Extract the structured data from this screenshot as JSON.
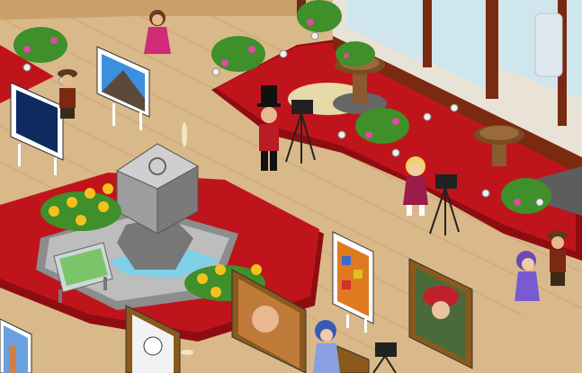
{
  "scene": {
    "title": "",
    "palette": {
      "floor": "#d9b98a",
      "floor_line": "#c9a472",
      "carpet": "#c0141c",
      "carpet_dark": "#8f0d12",
      "stone": "#8d8d8d",
      "stone_light": "#bdbdbd",
      "wall": "#e9e2d6",
      "window_frame": "#7a2a10",
      "window_glass": "#cfe6ee",
      "plant_green": "#3f8f2a",
      "flower_pink": "#e04aa0",
      "flower_yellow": "#f4c21c",
      "water": "#7fd0e8"
    }
  },
  "objects": [
    {
      "name": "painting-mountains",
      "icon": "mountain-painting-icon"
    },
    {
      "name": "painting-night-camels",
      "icon": "night-desert-painting-icon"
    },
    {
      "name": "painting-abstract-squares",
      "icon": "abstract-painting-icon"
    },
    {
      "name": "painting-red-hat-portrait",
      "icon": "portrait-painting-icon"
    },
    {
      "name": "painting-old-man-portrait",
      "icon": "portrait-painting-icon"
    },
    {
      "name": "painting-sketch-lady",
      "icon": "sketch-painting-icon"
    },
    {
      "name": "painting-city-buildings",
      "icon": "city-painting-icon"
    },
    {
      "name": "painting-small-portrait",
      "icon": "portrait-painting-icon"
    },
    {
      "name": "stone-cube-statue-fountain",
      "icon": "statue-icon"
    },
    {
      "name": "map-display-stand",
      "icon": "map-icon"
    },
    {
      "name": "tripod-camera-1",
      "icon": "camera-icon"
    },
    {
      "name": "tripod-camera-2",
      "icon": "camera-icon"
    },
    {
      "name": "tripod-camera-3",
      "icon": "camera-icon"
    },
    {
      "name": "pedestal-table-1",
      "icon": "pedestal-icon"
    },
    {
      "name": "pedestal-table-2",
      "icon": "pedestal-icon"
    },
    {
      "name": "avatar-pink-dress-girl",
      "icon": "avatar-icon"
    },
    {
      "name": "avatar-top-hat-guard",
      "icon": "avatar-icon"
    },
    {
      "name": "avatar-flat-cap-boy",
      "icon": "avatar-icon"
    },
    {
      "name": "avatar-blonde-girl",
      "icon": "avatar-icon"
    },
    {
      "name": "avatar-purple-bonnet-girl",
      "icon": "avatar-icon"
    },
    {
      "name": "avatar-blue-bonnet-girl",
      "icon": "avatar-icon"
    },
    {
      "name": "avatar-cap-boy-right",
      "icon": "avatar-icon"
    }
  ]
}
